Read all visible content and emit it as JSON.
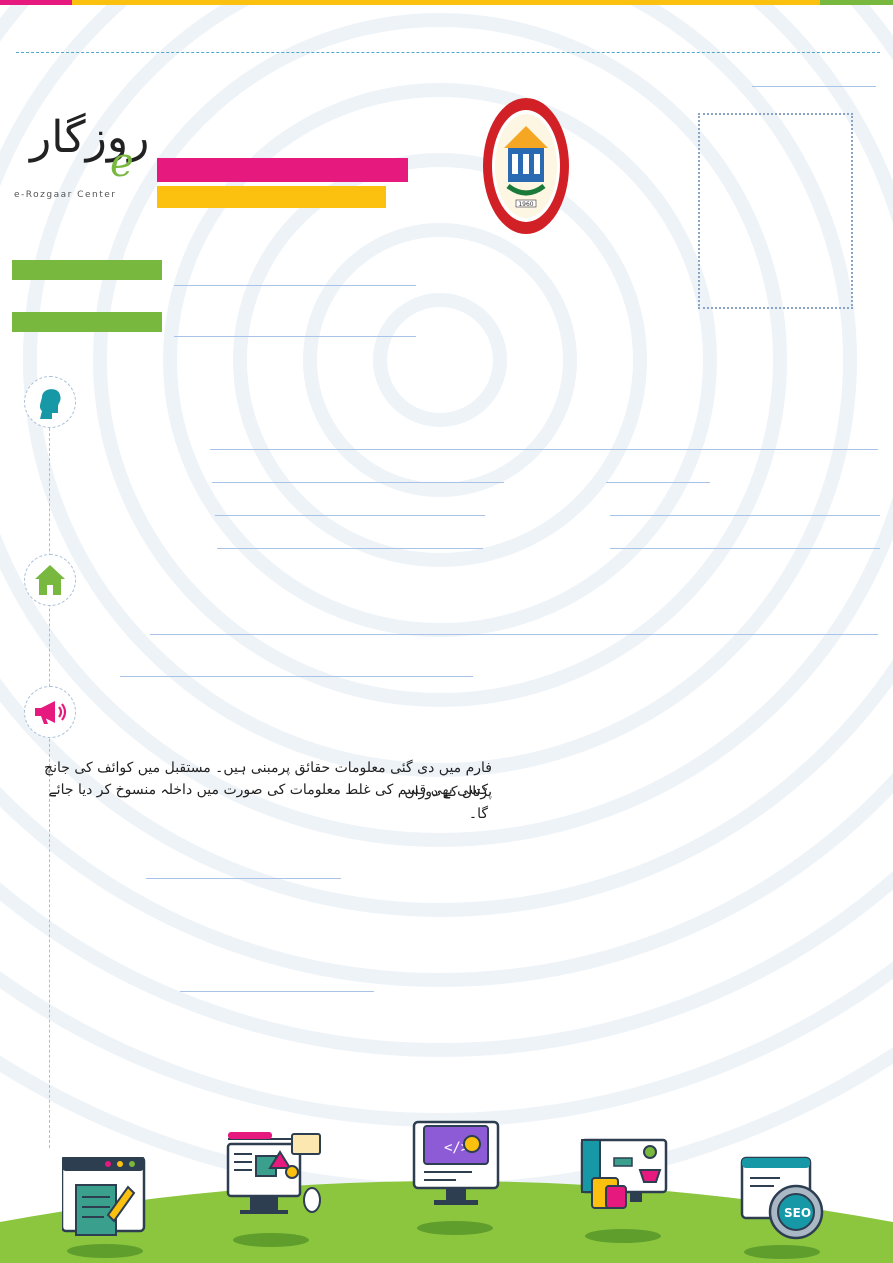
{
  "logo": {
    "urdu_wordmark": "روزگار",
    "latin_mark": "e",
    "subtitle": "e-Rozgaar Center"
  },
  "seal": {
    "ring_text": "INSTITUTE OF EDUCATION AND RESEARCH",
    "year": "1960"
  },
  "colors": {
    "magenta": "#e5197e",
    "yellow": "#fbc10e",
    "green": "#78b83f",
    "teal": "#1798a6",
    "rule": "#a9c3e6",
    "ground": "#8cc63f"
  },
  "icons": [
    "person-icon",
    "home-icon",
    "megaphone-icon"
  ],
  "notice": {
    "line1": "فارم میں دی گئی معلومات حقائق پرمبنی ہیں۔ مستقبل میں کوائف کی جانچ پڑتال کے دوران",
    "line2": "کسی بھی قسم کی غلط معلومات کی صورت میں داخلہ منسوخ کر دیا جائے گا۔"
  },
  "illustrations": [
    "form-edit-icon",
    "graphic-design-icon",
    "web-development-icon",
    "ecommerce-icon",
    "seo-icon"
  ]
}
